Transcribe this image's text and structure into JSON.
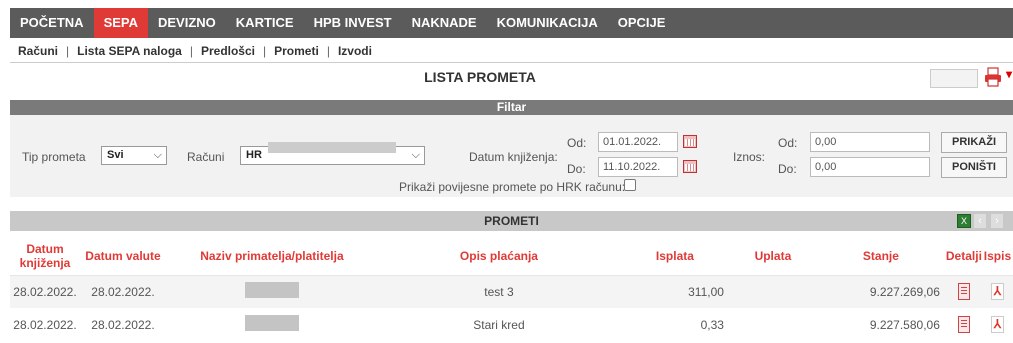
{
  "nav": {
    "items": [
      "POČETNA",
      "SEPA",
      "DEVIZNO",
      "KARTICE",
      "HPB INVEST",
      "NAKNADE",
      "KOMUNIKACIJA",
      "OPCIJE"
    ],
    "active": "SEPA"
  },
  "subnav": {
    "items": [
      "Računi",
      "Lista SEPA naloga",
      "Predlošci",
      "Prometi",
      "Izvodi"
    ],
    "separator": "|"
  },
  "page": {
    "title": "LISTA PROMETA"
  },
  "filter": {
    "title": "Filtar",
    "tip_prometa_label": "Tip prometa",
    "tip_prometa_value": "Svi",
    "racuni_label": "Računi",
    "racuni_value": "HR",
    "datum_label": "Datum knjiženja:",
    "od_label": "Od:",
    "do_label": "Do:",
    "date_from": "01.01.2022.",
    "date_to": "11.10.2022.",
    "iznos_label": "Iznos:",
    "amount_from": "0,00",
    "amount_to": "0,00",
    "prikazi_button": "PRIKAŽI",
    "ponisti_button": "PONIŠTI",
    "history_checkbox_label": "Prikaži povijesne promete po HRK računu:"
  },
  "results": {
    "title": "PROMETI",
    "columns": [
      "Datum knjiženja",
      "Datum valute",
      "Naziv primatelja/platitelja",
      "Opis plaćanja",
      "Isplata",
      "Uplata",
      "Stanje",
      "Detalji",
      "Ispis"
    ],
    "rows": [
      {
        "datum_knjizenja": "28.02.2022.",
        "datum_valute": "28.02.2022.",
        "opis": "test 3",
        "isplata": "311,00",
        "uplata": "",
        "stanje": "9.227.269,06"
      },
      {
        "datum_knjizenja": "28.02.2022.",
        "datum_valute": "28.02.2022.",
        "opis": "Stari kred",
        "isplata": "0,33",
        "uplata": "",
        "stanje": "9.227.580,06"
      }
    ]
  },
  "colors": {
    "accent": "#e03a36",
    "nav_bg": "#5b5b5b",
    "filter_bar": "#7a7a7a"
  }
}
